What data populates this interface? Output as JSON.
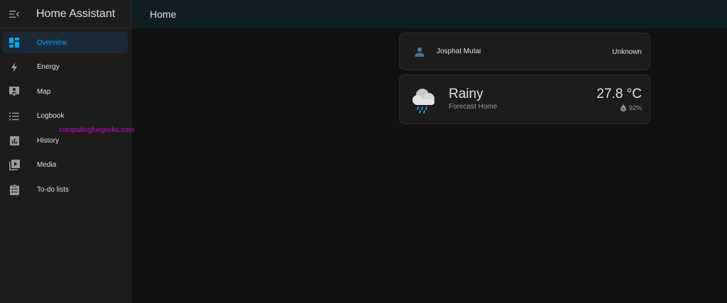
{
  "sidebar": {
    "app_title": "Home Assistant",
    "items": [
      {
        "label": "Overview",
        "icon": "dashboard-icon",
        "active": true
      },
      {
        "label": "Energy",
        "icon": "lightning-bolt-icon"
      },
      {
        "label": "Map",
        "icon": "map-marker-icon"
      },
      {
        "label": "Logbook",
        "icon": "list-icon"
      },
      {
        "label": "History",
        "icon": "chart-bar-icon"
      },
      {
        "label": "Media",
        "icon": "play-box-icon"
      },
      {
        "label": "To-do lists",
        "icon": "clipboard-list-icon"
      }
    ]
  },
  "watermark": "computingforgeeks.com",
  "header": {
    "title": "Home"
  },
  "person_card": {
    "name": "Josphat Mutai",
    "state": "Unknown",
    "icon": "account-icon"
  },
  "weather_card": {
    "state": "Rainy",
    "name": "Forecast Home",
    "temperature": "27.8 °C",
    "humidity": "92%",
    "icon": "weather-rainy-icon"
  },
  "colors": {
    "accent": "#03a9f4",
    "sidebar_bg": "#1c1c1c",
    "header_bg": "#101e24",
    "page_bg": "#111111",
    "watermark": "#d600d6"
  }
}
